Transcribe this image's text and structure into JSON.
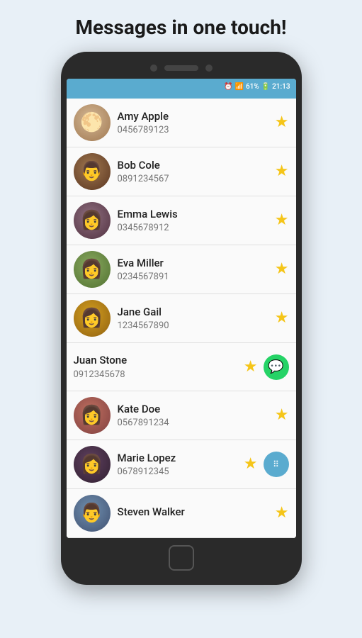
{
  "headline": "Messages in one touch!",
  "statusBar": {
    "time": "21:13",
    "battery": "61%"
  },
  "contacts": [
    {
      "id": "amy",
      "name": "Amy Apple",
      "phone": "0456789123",
      "starred": true,
      "hasWhatsapp": false,
      "avatarClass": "avatar-amy",
      "avatarEmoji": "🌙"
    },
    {
      "id": "bob",
      "name": "Bob Cole",
      "phone": "0891234567",
      "starred": true,
      "hasWhatsapp": false,
      "avatarClass": "avatar-bob",
      "avatarEmoji": "👤"
    },
    {
      "id": "emma",
      "name": "Emma Lewis",
      "phone": "0345678912",
      "starred": true,
      "hasWhatsapp": false,
      "avatarClass": "avatar-emma",
      "avatarEmoji": "👤"
    },
    {
      "id": "eva",
      "name": "Eva Miller",
      "phone": "0234567891",
      "starred": true,
      "hasWhatsapp": false,
      "avatarClass": "avatar-eva",
      "avatarEmoji": "👤"
    },
    {
      "id": "jane",
      "name": "Jane Gail",
      "phone": "1234567890",
      "starred": true,
      "hasWhatsapp": false,
      "avatarClass": "avatar-jane",
      "avatarEmoji": "👤"
    },
    {
      "id": "juan",
      "name": "Juan Stone",
      "phone": "0912345678",
      "starred": true,
      "hasWhatsapp": true,
      "noAvatar": true,
      "avatarClass": "",
      "avatarEmoji": ""
    },
    {
      "id": "kate",
      "name": "Kate Doe",
      "phone": "0567891234",
      "starred": true,
      "hasWhatsapp": false,
      "avatarClass": "avatar-kate",
      "avatarEmoji": "👤"
    },
    {
      "id": "marie",
      "name": "Marie Lopez",
      "phone": "0678912345",
      "starred": true,
      "hasWhatsapp": false,
      "avatarClass": "avatar-marie",
      "hasFab": true,
      "avatarEmoji": "👤"
    },
    {
      "id": "steven",
      "name": "Steven Walker",
      "phone": "",
      "starred": true,
      "hasWhatsapp": false,
      "avatarClass": "avatar-steven",
      "avatarEmoji": "👤"
    }
  ]
}
